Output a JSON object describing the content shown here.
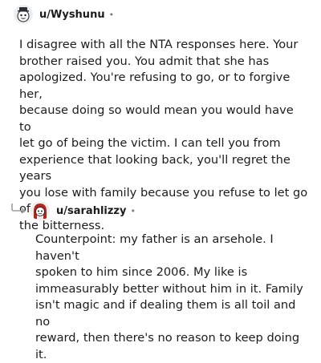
{
  "comments": [
    {
      "username": "u/Wyshunu",
      "separator": "•",
      "avatar_icon": "snoo-avatar-icon",
      "lines": [
        "I disagree with all the NTA responses here. Your",
        "brother raised you. You admit that she has",
        "apologized. You're refusing to go, or to forgive her,",
        "because doing so would mean you would have to",
        "let go of being the victim. I can tell you from",
        "experience that looking back, you'll regret the years",
        "you lose with family because you refuse to let go of",
        "the bitterness."
      ]
    },
    {
      "username": "u/sarahlizzy",
      "separator": "•",
      "avatar_icon": "snoo-avatar-red-hair-icon",
      "reply_icon": "reply-arrow-icon",
      "lines": [
        "Counterpoint: my father is an arsehole. I haven't",
        "spoken to him since 2006. My like is",
        "immeasurably better without him in it. Family",
        "isn't magic and if dealing them is all toil and no",
        "reward, then there's no reason to keep doing it."
      ]
    }
  ],
  "colors": {
    "text": "#1c1c1c",
    "meta": "#7c7c7c",
    "background": "#ffffff"
  }
}
